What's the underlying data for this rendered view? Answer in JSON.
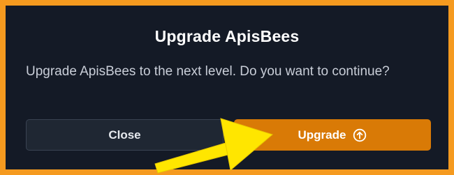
{
  "dialog": {
    "title": "Upgrade ApisBees",
    "message": "Upgrade ApisBees to the next level. Do you want to continue?",
    "close_label": "Close",
    "upgrade_label": "Upgrade",
    "upgrade_icon": "arrow-up-circle-icon"
  },
  "colors": {
    "frame": "#f59a1f",
    "background": "#141a26",
    "accent": "#d97a06",
    "annotation_arrow": "#ffe600"
  }
}
